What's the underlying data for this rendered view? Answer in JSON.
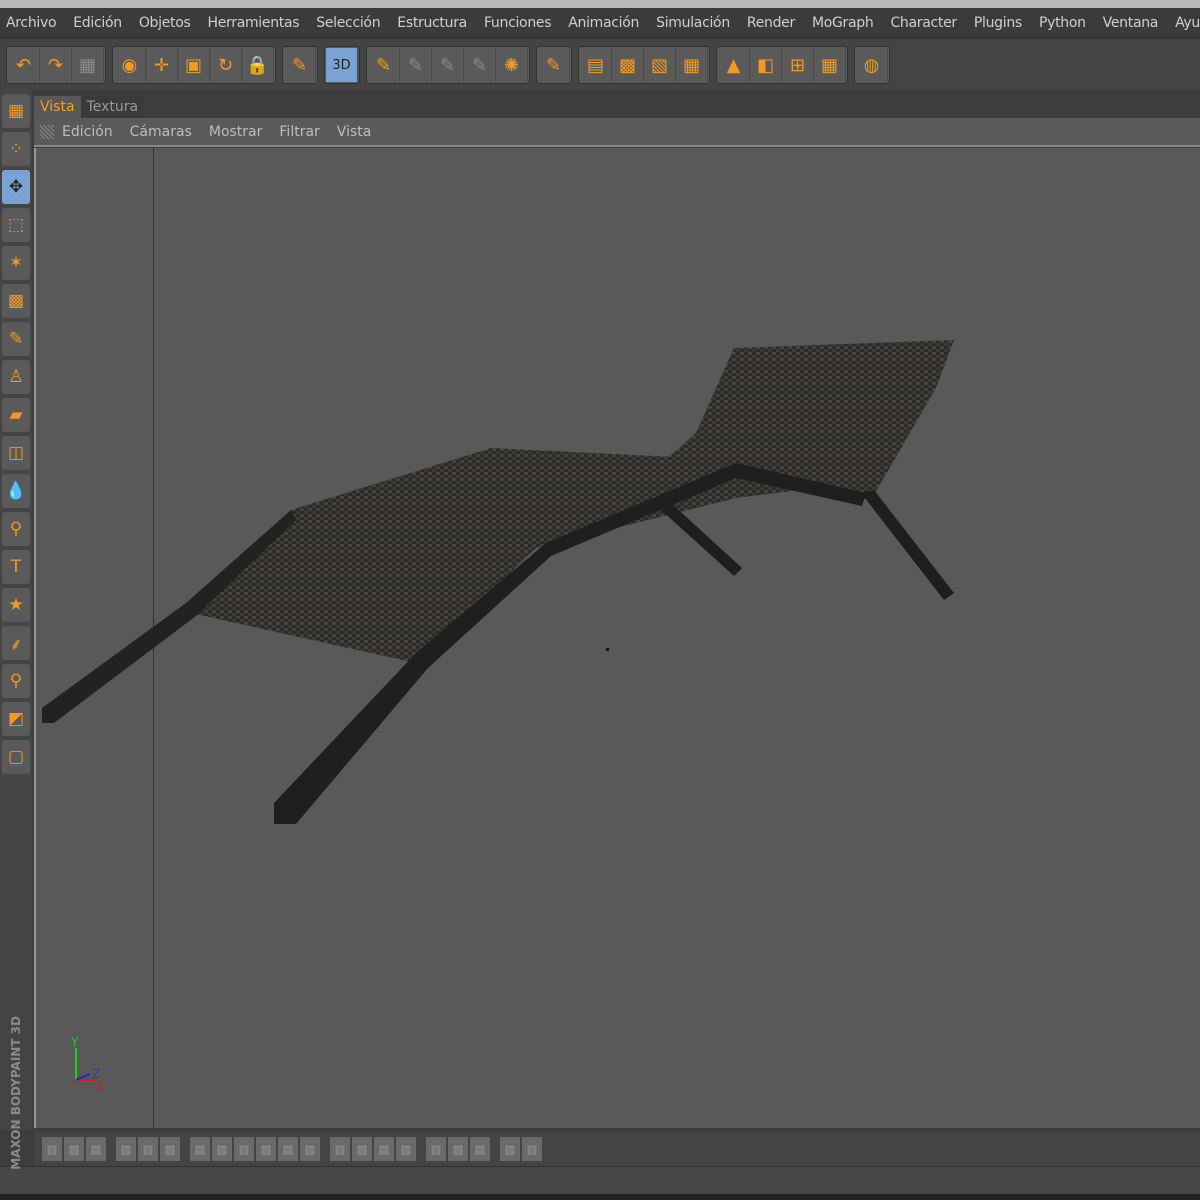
{
  "menu": [
    "Archivo",
    "Edición",
    "Objetos",
    "Herramientas",
    "Selección",
    "Estructura",
    "Funciones",
    "Animación",
    "Simulación",
    "Render",
    "MoGraph",
    "Character",
    "Plugins",
    "Python",
    "Ventana",
    "Ayuda"
  ],
  "toolbar": {
    "groups": [
      [
        {
          "icon": "undo-icon",
          "g": "↶"
        },
        {
          "icon": "redo-icon",
          "g": "↷"
        },
        {
          "icon": "reset-icon",
          "g": "▦",
          "dim": true
        }
      ],
      [
        {
          "icon": "select-icon",
          "g": "◉"
        },
        {
          "icon": "move-icon",
          "g": "✛"
        },
        {
          "icon": "scale-icon",
          "g": "▣"
        },
        {
          "icon": "rotate-icon",
          "g": "↻"
        },
        {
          "icon": "lock-icon",
          "g": "🔒"
        }
      ],
      [
        {
          "icon": "paint-brush-icon",
          "g": "✎"
        }
      ],
      [
        {
          "icon": "paint-3d-icon",
          "g": "3D",
          "on": true
        }
      ],
      [
        {
          "icon": "paint-all-channels-icon",
          "g": "✎"
        },
        {
          "icon": "channel-icon",
          "g": "✎",
          "dim": true
        },
        {
          "icon": "channel-check-icon",
          "g": "✎",
          "dim": true
        },
        {
          "icon": "channel-x-icon",
          "g": "✎",
          "dim": true
        },
        {
          "icon": "texture-wheel-icon",
          "g": "✺"
        }
      ],
      [
        {
          "icon": "projection-paint-icon",
          "g": "✎"
        }
      ],
      [
        {
          "icon": "uv-polygons-icon",
          "g": "▤"
        },
        {
          "icon": "uv-points-icon",
          "g": "▩"
        },
        {
          "icon": "uv-edges-icon",
          "g": "▧"
        },
        {
          "icon": "checker-icon",
          "g": "▦"
        }
      ],
      [
        {
          "icon": "layout-icon",
          "g": "▲"
        },
        {
          "icon": "layout-2-icon",
          "g": "◧"
        },
        {
          "icon": "layout-4-icon",
          "g": "⊞"
        },
        {
          "icon": "layout-grid-icon",
          "g": "▦"
        }
      ],
      [
        {
          "icon": "render-icon",
          "g": "◍"
        }
      ]
    ]
  },
  "sidebar": [
    {
      "icon": "layout-icon",
      "g": "▦"
    },
    {
      "icon": "mode-icon",
      "g": "⁘"
    },
    {
      "icon": "move-icon",
      "g": "✥",
      "on": true
    },
    {
      "icon": "rect-select-icon",
      "g": "⬚"
    },
    {
      "icon": "magic-wand-icon",
      "g": "✶"
    },
    {
      "icon": "fill-icon",
      "g": "▩"
    },
    {
      "icon": "brush-icon",
      "g": "✎"
    },
    {
      "icon": "stamp-icon",
      "g": "♙"
    },
    {
      "icon": "eraser-icon",
      "g": "▰"
    },
    {
      "icon": "gradient-icon",
      "g": "◫"
    },
    {
      "icon": "blur-icon",
      "g": "💧"
    },
    {
      "icon": "zoom-icon",
      "g": "⚲"
    },
    {
      "icon": "text-icon",
      "g": "T"
    },
    {
      "icon": "star-icon",
      "g": "★"
    },
    {
      "icon": "eyedropper-icon",
      "g": "⸙"
    },
    {
      "icon": "clone-icon",
      "g": "⚲"
    },
    {
      "icon": "color-swatch-icon",
      "g": "◩"
    },
    {
      "icon": "layer-icon",
      "g": "▢"
    }
  ],
  "brand": "MAXON BODYPAINT 3D",
  "tabs": [
    "Vista",
    "Textura"
  ],
  "viewport_menu": [
    "Edición",
    "Cámaras",
    "Mostrar",
    "Filtrar",
    "Vista"
  ],
  "axes": {
    "y": "Y",
    "z": "Z",
    "x": "X"
  },
  "colors": {
    "accent": "#f5a012",
    "viewport": "#595959"
  },
  "bottom_groups": [
    3,
    3,
    6,
    4,
    3,
    2
  ]
}
